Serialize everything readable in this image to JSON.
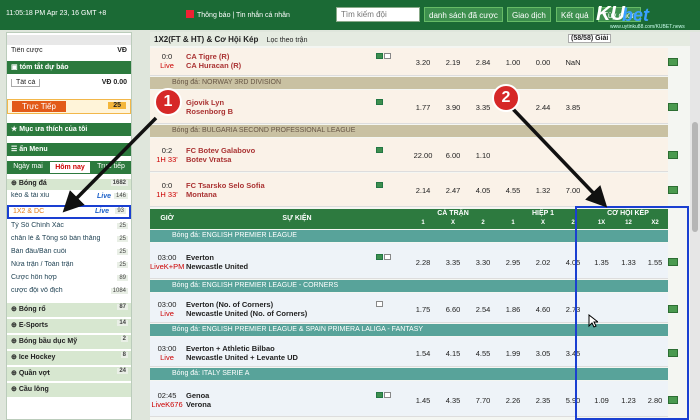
{
  "topbar": {
    "clock": "11:05:18 PM Apr 23,  16 GMT +8",
    "notice": "Thông báo | Tin nhắn cá nhân",
    "search_placeholder": "Tìm kiếm đội",
    "nav": [
      "danh sách đã cược",
      "Giao dịch",
      "Kết quả",
      "Tùy chọn"
    ],
    "logo_k": "KU",
    "logo_b": "bet",
    "logo_url": "www.uytinku88.com/KUBET.news"
  },
  "sidebar": {
    "balance_label": "Tiền cược",
    "balance_value": "VĐ",
    "slip_title": "tóm tắt dự báo",
    "slip_select": "Tất cả",
    "slip_value": "VĐ 0.00",
    "live_label": "Trực Tiếp",
    "live_count": "25",
    "fav_label": "Mục ưa thích của tôi",
    "menu_label": "ẩn Menu",
    "tabs": [
      "Ngày mai",
      "Hôm nay",
      "Trực tiếp"
    ],
    "sports_head": "Bóng đá",
    "sports_head_count": "1682",
    "items": [
      {
        "label": "kèo & tài xỉu",
        "count": "146",
        "live": "Live"
      },
      {
        "label": "1X2 & DC",
        "count": "93",
        "live": "Live"
      },
      {
        "label": "Tỷ Số Chính Xác",
        "count": "25",
        "live": ""
      },
      {
        "label": "chẵn lẻ & Tổng số bàn thắng",
        "count": "25",
        "live": ""
      },
      {
        "label": "Bàn đầu/Bàn cuối",
        "count": "25",
        "live": ""
      },
      {
        "label": "Nửa trận / Toàn trận",
        "count": "25",
        "live": ""
      },
      {
        "label": "Cược hỗn hợp",
        "count": "89",
        "live": ""
      },
      {
        "label": "cược đội vô địch",
        "count": "1084",
        "live": ""
      }
    ],
    "sports": [
      {
        "label": "Bóng rổ",
        "count": "87"
      },
      {
        "label": "E-Sports",
        "count": "14"
      },
      {
        "label": "Bóng bầu dục Mỹ",
        "count": "2"
      },
      {
        "label": "Ice Hockey",
        "count": "8"
      },
      {
        "label": "Quần vợt",
        "count": "24"
      },
      {
        "label": "Cầu lông",
        "count": ""
      }
    ]
  },
  "main": {
    "title": "1X2(FT & HT) & Cơ Hội Kép",
    "filter": "Lọc theo trận",
    "page": "(58/58) Giải",
    "top_rows": [
      {
        "score": "0:0",
        "status": "Live",
        "home": "CA Tigre (R)",
        "away": "CA Huracan (R)",
        "odds": [
          "3.20",
          "2.19",
          "2.84",
          "1.00",
          "0.00",
          "NaN"
        ]
      }
    ],
    "leagues_top": [
      {
        "name": "Bóng đá: NORWAY 3RD DIVISION",
        "matches": [
          {
            "score": "",
            "status": "",
            "home": "Gjovik Lyn",
            "away": "Rosenborg B",
            "odds": [
              "1.77",
              "3.90",
              "3.35",
              "2.44",
              "3.85"
            ]
          }
        ]
      },
      {
        "name": "Bóng đá: BULGARIA SECOND PROFESSIONAL LEAGUE",
        "matches": [
          {
            "score": "0:2",
            "status": "1H 33'",
            "home": "FC Botev Galabovo",
            "away": "Botev Vratsa",
            "odds": [
              "22.00",
              "6.00",
              "1.10"
            ]
          },
          {
            "score": "0:0",
            "status": "1H 33'",
            "home": "FC Tsarsko Selo Sofia",
            "away": "Montana",
            "odds": [
              "2.14",
              "2.47",
              "4.05",
              "4.55",
              "1.32",
              "7.00"
            ]
          }
        ]
      }
    ],
    "columns": {
      "time": "GIỜ",
      "event": "SỰ KIỆN",
      "full": "CẢ TRẬN",
      "half": "HIỆP 1",
      "dc": "CƠ HỘI KÉP",
      "sub": [
        "1",
        "X",
        "2",
        "1",
        "X",
        "2",
        "1X",
        "12",
        "X2"
      ]
    },
    "leagues": [
      {
        "name": "Bóng đá: ENGLISH PREMIER LEAGUE",
        "matches": [
          {
            "time": "03:00",
            "status": "LiveK+PM",
            "home": "Everton",
            "away": "Newcastle United",
            "odds": [
              "2.28",
              "3.35",
              "3.30",
              "2.95",
              "2.02",
              "4.05",
              "1.35",
              "1.33",
              "1.55"
            ]
          }
        ]
      },
      {
        "name": "Bóng đá: ENGLISH PREMIER LEAGUE - CORNERS",
        "matches": [
          {
            "time": "03:00",
            "status": "Live",
            "home": "Everton (No. of Corners)",
            "away": "Newcastle United (No. of Corners)",
            "odds": [
              "1.75",
              "6.60",
              "2.54",
              "1.86",
              "4.60",
              "2.73"
            ]
          }
        ]
      },
      {
        "name": "Bóng đá: ENGLISH PREMIER LEAGUE & SPAIN PRIMERA LALIGA - FANTASY",
        "matches": [
          {
            "time": "03:00",
            "status": "Live",
            "home": "Everton + Athletic Bilbao",
            "away": "Newcastle United + Levante UD",
            "odds": [
              "1.54",
              "4.15",
              "4.55",
              "1.99",
              "3.05",
              "3.45"
            ]
          }
        ]
      },
      {
        "name": "Bóng đá: ITALY SERIE A",
        "matches": [
          {
            "time": "02:45",
            "status": "LiveK676",
            "home": "Genoa",
            "away": "Verona",
            "odds": [
              "1.45",
              "4.35",
              "7.70",
              "2.26",
              "2.35",
              "5.90",
              "1.09",
              "1.23",
              "2.80"
            ]
          }
        ]
      }
    ]
  },
  "callouts": [
    "1",
    "2"
  ],
  "colors": {
    "header": "#1b6a35",
    "accent": "#2c7a3e",
    "highlight": "#1a3fd1",
    "callout": "#d62828"
  }
}
